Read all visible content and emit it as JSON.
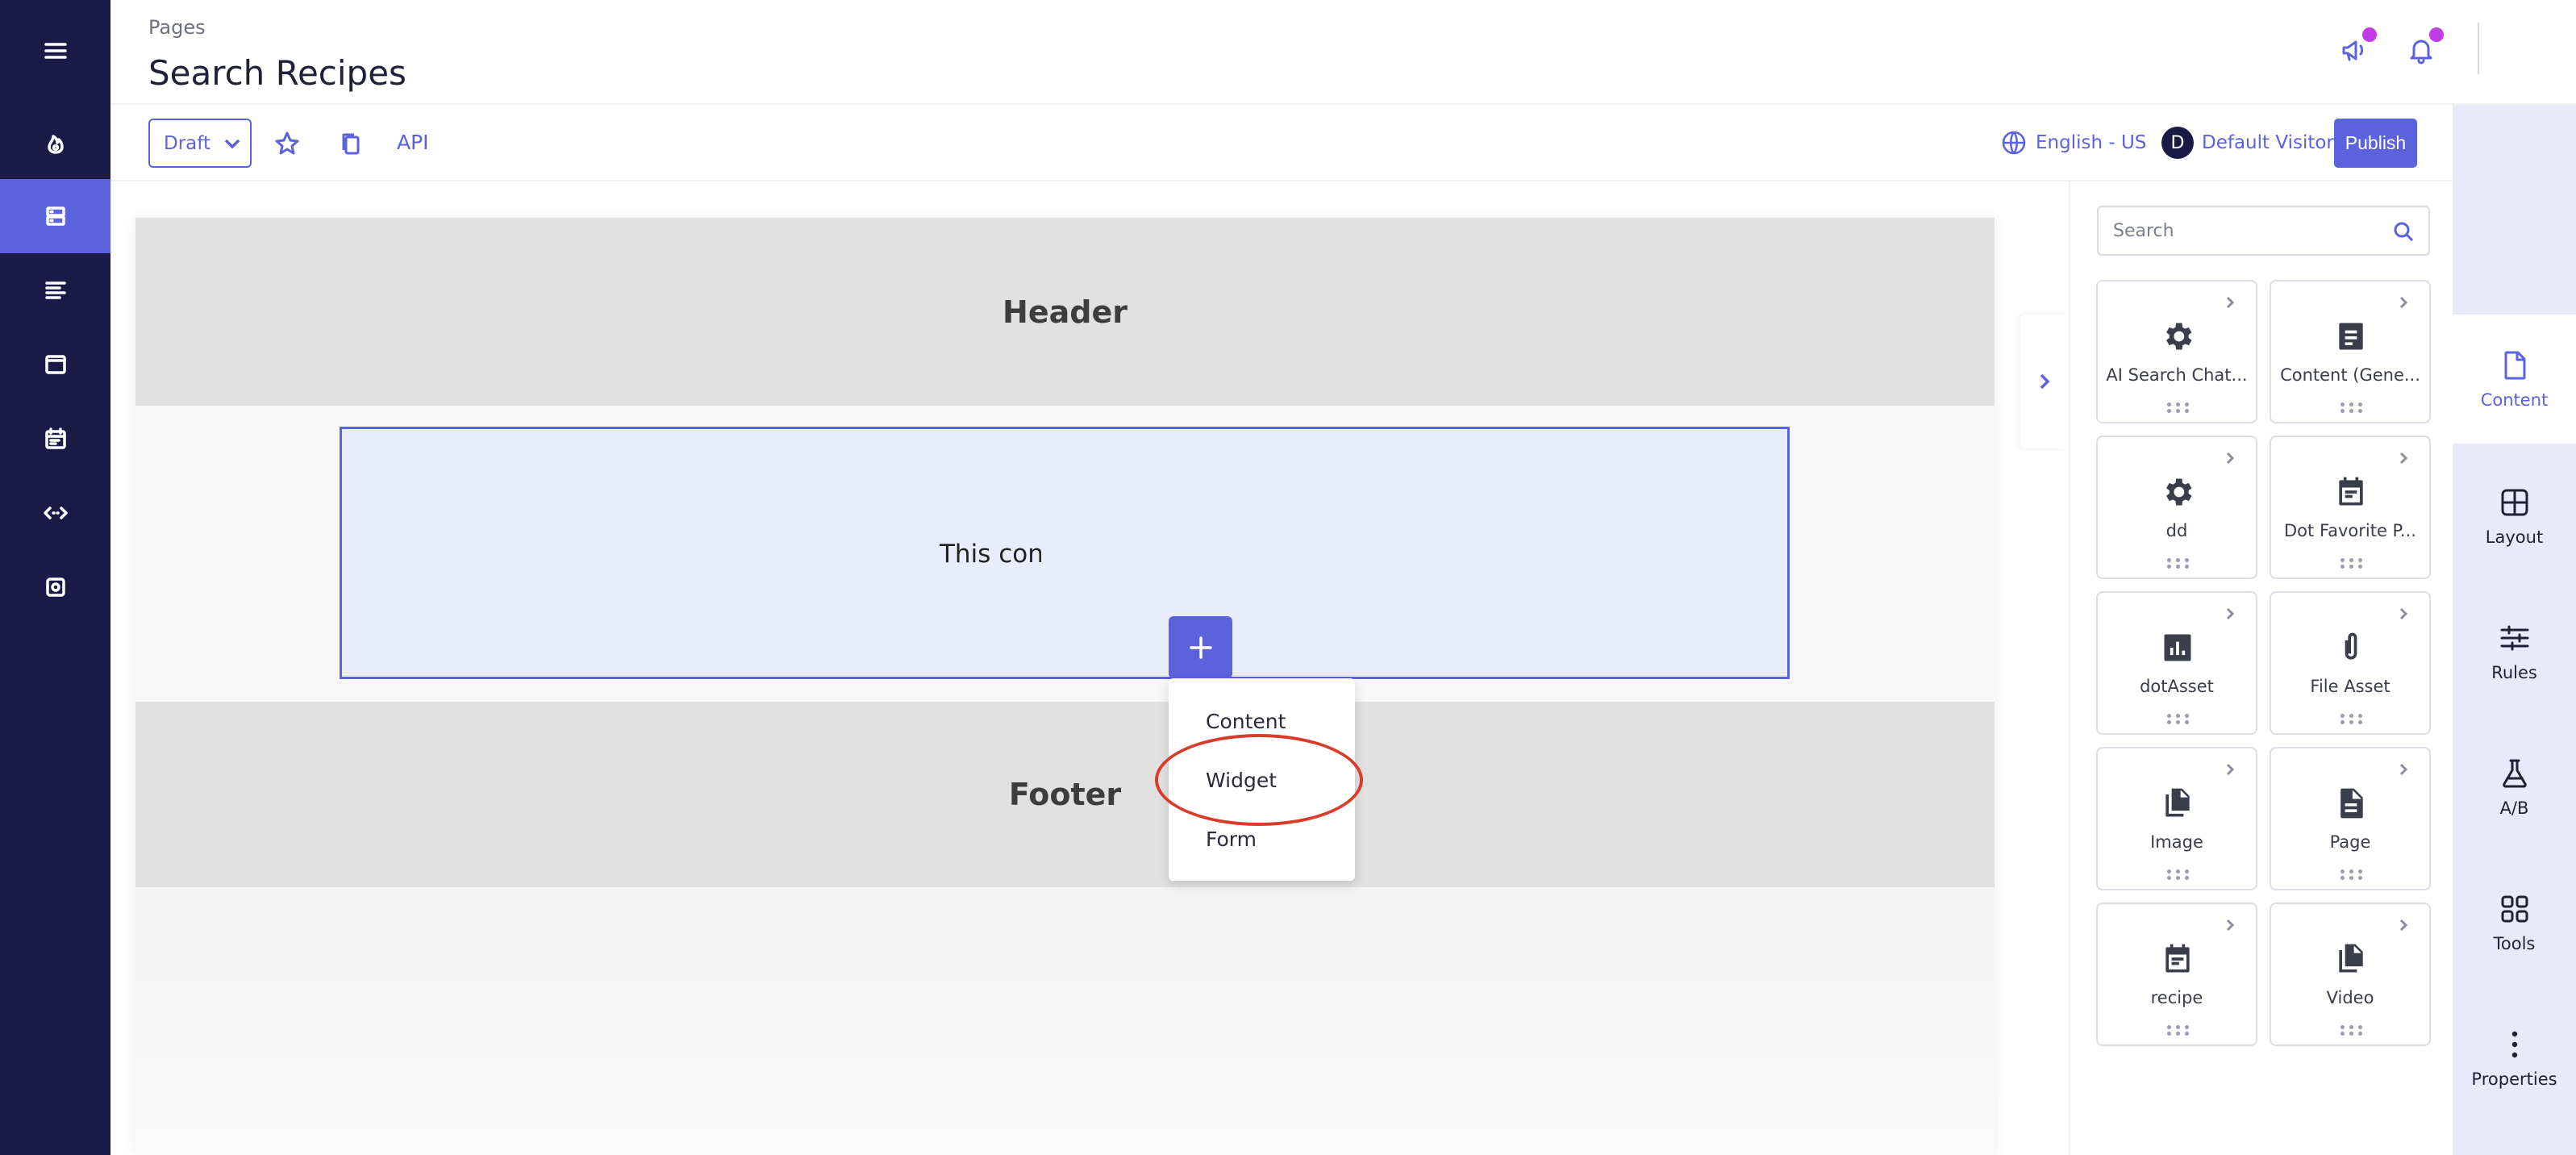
{
  "app": {
    "breadcrumb": "Pages",
    "title": "Search Recipes"
  },
  "left_nav": {
    "items": [
      {
        "icon": "menu-icon"
      },
      {
        "icon": "flame-icon"
      },
      {
        "icon": "site-icon",
        "active": true
      },
      {
        "icon": "content-list-icon"
      },
      {
        "icon": "window-icon"
      },
      {
        "icon": "calendar-icon"
      },
      {
        "icon": "code-icon"
      },
      {
        "icon": "settings-icon"
      }
    ]
  },
  "topbar": {
    "announcement_icon": "megaphone-icon",
    "notification_icon": "bell-icon",
    "badge_color": "#c23ce6"
  },
  "toolbar": {
    "mode_value": "Draft",
    "favorite_icon": "star-icon",
    "copy_icon": "copy-icon",
    "api_label": "API",
    "language_label": "English - US",
    "visitor_initial": "D",
    "visitor_label": "Default Visitor",
    "publish_label": "Publish"
  },
  "canvas": {
    "header_label": "Header",
    "contentlet_text": "This content",
    "footer_label": "Footer",
    "add_menu": {
      "items": [
        "Content",
        "Widget",
        "Form"
      ],
      "highlighted": "Widget"
    }
  },
  "palette": {
    "search_placeholder": "Search",
    "tiles": [
      {
        "label": "AI Search Chat...",
        "icon": "gear-icon"
      },
      {
        "label": "Content (Gene...",
        "icon": "document-icon"
      },
      {
        "label": "dd",
        "icon": "gear-icon"
      },
      {
        "label": "Dot Favorite P...",
        "icon": "calendar-icon"
      },
      {
        "label": "dotAsset",
        "icon": "bar-chart-icon"
      },
      {
        "label": "File Asset",
        "icon": "paperclip-icon"
      },
      {
        "label": "Image",
        "icon": "files-icon"
      },
      {
        "label": "Page",
        "icon": "document-icon"
      },
      {
        "label": "recipe",
        "icon": "calendar-icon"
      },
      {
        "label": "Video",
        "icon": "files-icon"
      }
    ]
  },
  "right_rail": {
    "items": [
      {
        "label": "Content",
        "icon": "file-icon",
        "active": true
      },
      {
        "label": "Layout",
        "icon": "grid-icon"
      },
      {
        "label": "Rules",
        "icon": "sliders-icon"
      },
      {
        "label": "A/B",
        "icon": "flask-icon"
      },
      {
        "label": "Tools",
        "icon": "apps-icon"
      },
      {
        "label": "Properties",
        "icon": "kebab-icon"
      }
    ]
  },
  "colors": {
    "accent": "#5b63dc",
    "nav_bg": "#1b1a47",
    "highlight_ring": "#d93c2b"
  }
}
